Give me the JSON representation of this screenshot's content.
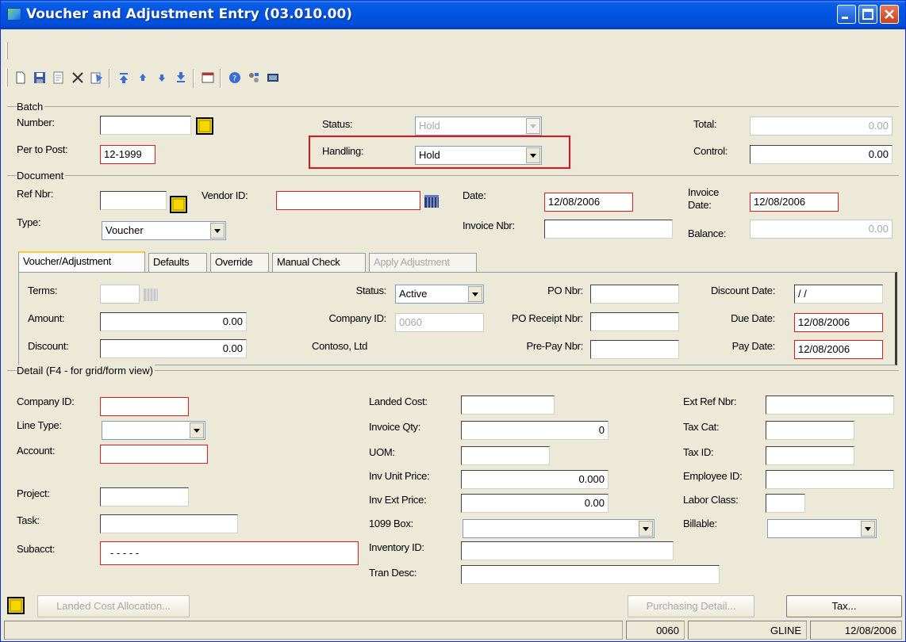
{
  "window": {
    "title": "Voucher and Adjustment Entry (03.010.00)"
  },
  "toolbar": {
    "icons": [
      "new-icon",
      "save-icon",
      "copy-icon",
      "delete-icon",
      "paste-icon",
      "first-icon",
      "previous-icon",
      "next-icon",
      "last-icon",
      "form-icon",
      "help-icon",
      "customize-icon",
      "quick-send-icon"
    ]
  },
  "batch": {
    "header": "Batch",
    "number_label": "Number:",
    "number_value": "",
    "per_to_post_label": "Per to Post:",
    "per_to_post_value": "12-1999",
    "status_label": "Status:",
    "status_value": "Hold",
    "handling_label": "Handling:",
    "handling_value": "Hold",
    "total_label": "Total:",
    "total_value": "0.00",
    "control_label": "Control:",
    "control_value": "0.00"
  },
  "document": {
    "header": "Document",
    "ref_nbr_label": "Ref Nbr:",
    "ref_nbr_value": "",
    "vendor_id_label": "Vendor ID:",
    "vendor_id_value": "",
    "date_label": "Date:",
    "date_value": "12/08/2006",
    "invoice_date_label_1": "Invoice",
    "invoice_date_label_2": "Date:",
    "invoice_date_value": "12/08/2006",
    "type_label": "Type:",
    "type_value": "Voucher",
    "invoice_nbr_label": "Invoice Nbr:",
    "invoice_nbr_value": "",
    "balance_label": "Balance:",
    "balance_value": "0.00"
  },
  "tabs": [
    {
      "label": "Voucher/Adjustment"
    },
    {
      "label": "Defaults"
    },
    {
      "label": "Override"
    },
    {
      "label": "Manual Check"
    },
    {
      "label": "Apply Adjustment"
    }
  ],
  "voucher_tab": {
    "terms_label": "Terms:",
    "terms_value": "",
    "amount_label": "Amount:",
    "amount_value": "0.00",
    "discount_label": "Discount:",
    "discount_value": "0.00",
    "status_label": "Status:",
    "status_value": "Active",
    "company_id_label": "Company ID:",
    "company_id_value": "0060",
    "company_name": "Contoso, Ltd",
    "po_nbr_label": "PO Nbr:",
    "po_nbr_value": "",
    "po_receipt_nbr_label": "PO Receipt Nbr:",
    "po_receipt_nbr_value": "",
    "pre_pay_nbr_label": "Pre-Pay Nbr:",
    "pre_pay_nbr_value": "",
    "discount_date_label": "Discount Date:",
    "discount_date_value": "/ /",
    "due_date_label": "Due Date:",
    "due_date_value": "12/08/2006",
    "pay_date_label": "Pay Date:",
    "pay_date_value": "12/08/2006"
  },
  "detail": {
    "header": "Detail  (F4 - for grid/form view)",
    "company_id_label": "Company ID:",
    "company_id_value": "",
    "line_type_label": "Line Type:",
    "line_type_value": "",
    "account_label": "Account:",
    "account_value": "",
    "project_label": "Project:",
    "project_value": "",
    "task_label": "Task:",
    "task_value": "",
    "subacct_label": "Subacct:",
    "subacct_value": "- - - - -",
    "landed_cost_label": "Landed Cost:",
    "landed_cost_value": "",
    "invoice_qty_label": "Invoice Qty:",
    "invoice_qty_value": "0",
    "uom_label": "UOM:",
    "uom_value": "",
    "inv_unit_price_label": "Inv Unit Price:",
    "inv_unit_price_value": "0.000",
    "inv_ext_price_label": "Inv Ext Price:",
    "inv_ext_price_value": "0.00",
    "box_1099_label": "1099 Box:",
    "box_1099_value": "",
    "inventory_id_label": "Inventory ID:",
    "inventory_id_value": "",
    "tran_desc_label": "Tran Desc:",
    "tran_desc_value": "",
    "ext_ref_nbr_label": "Ext Ref Nbr:",
    "ext_ref_nbr_value": "",
    "tax_cat_label": "Tax Cat:",
    "tax_cat_value": "",
    "tax_id_label": "Tax ID:",
    "tax_id_value": "",
    "employee_id_label": "Employee ID:",
    "employee_id_value": "",
    "labor_class_label": "Labor Class:",
    "labor_class_value": "",
    "billable_label": "Billable:",
    "billable_value": ""
  },
  "buttons": {
    "landed_cost_allocation": "Landed Cost Allocation...",
    "purchasing_detail": "Purchasing Detail...",
    "tax": "Tax..."
  },
  "statusbar": {
    "company": "0060",
    "user": "GLINE",
    "date": "12/08/2006"
  },
  "colors": {
    "title_bar": "#0054e3",
    "required_border": "#d62020",
    "annotation_red": "#e0141e",
    "note_yellow": "#f5d800"
  }
}
